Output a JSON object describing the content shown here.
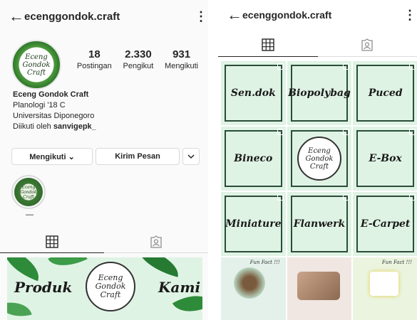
{
  "left": {
    "topbar": {
      "back_icon": "arrow-left-icon",
      "username": "ecenggondok.craft",
      "menu_icon": "more-vertical-icon"
    },
    "avatar_text": "Eceng\nGondok\nCraft",
    "stats": [
      {
        "value": "18",
        "label": "Postingan"
      },
      {
        "value": "2.330",
        "label": "Pengikut"
      },
      {
        "value": "931",
        "label": "Mengikuti"
      }
    ],
    "bio": {
      "name": "Eceng Gondok Craft",
      "line1": "Planologi '18 C",
      "line2": "Universitas Diponegoro",
      "followed_prefix": "Diikuti oleh ",
      "followed_user": "sanvigepk_"
    },
    "buttons": {
      "following": "Mengikuti ⌄",
      "message": "Kirim Pesan",
      "dropdown_icon": "chevron-down-icon"
    },
    "highlight": {
      "label": "—"
    },
    "tabs": [
      {
        "icon": "grid-icon",
        "active": true
      },
      {
        "icon": "tagged-icon",
        "active": false
      }
    ],
    "banner": {
      "left_text": "Produk",
      "right_text": "Kami",
      "logo_text": "Eceng\nGondok\nCraft"
    }
  },
  "right": {
    "topbar": {
      "back_icon": "arrow-left-icon",
      "username": "ecenggondok.craft",
      "menu_icon": "more-vertical-icon"
    },
    "tabs": [
      {
        "icon": "grid-icon",
        "active": true
      },
      {
        "icon": "tagged-icon",
        "active": false
      }
    ],
    "grid": [
      {
        "label": "Sen.dok"
      },
      {
        "label": "Biopolybag"
      },
      {
        "label": "Puced"
      },
      {
        "label": "Bineco"
      },
      {
        "logo": "Eceng\nGondok\nCraft"
      },
      {
        "label": "E-Box"
      },
      {
        "label": "Miniature"
      },
      {
        "label": "Flanwerk"
      },
      {
        "label": "E-Carpet"
      },
      {
        "funfact": "Fun Fact !!!"
      },
      {
        "funfact": ""
      },
      {
        "funfact": "Fun Fact !!!"
      }
    ]
  },
  "colors": {
    "accent_green": "#2e8b3a",
    "tile_bg": "#dff3e4",
    "border": "#dbdbdb"
  }
}
